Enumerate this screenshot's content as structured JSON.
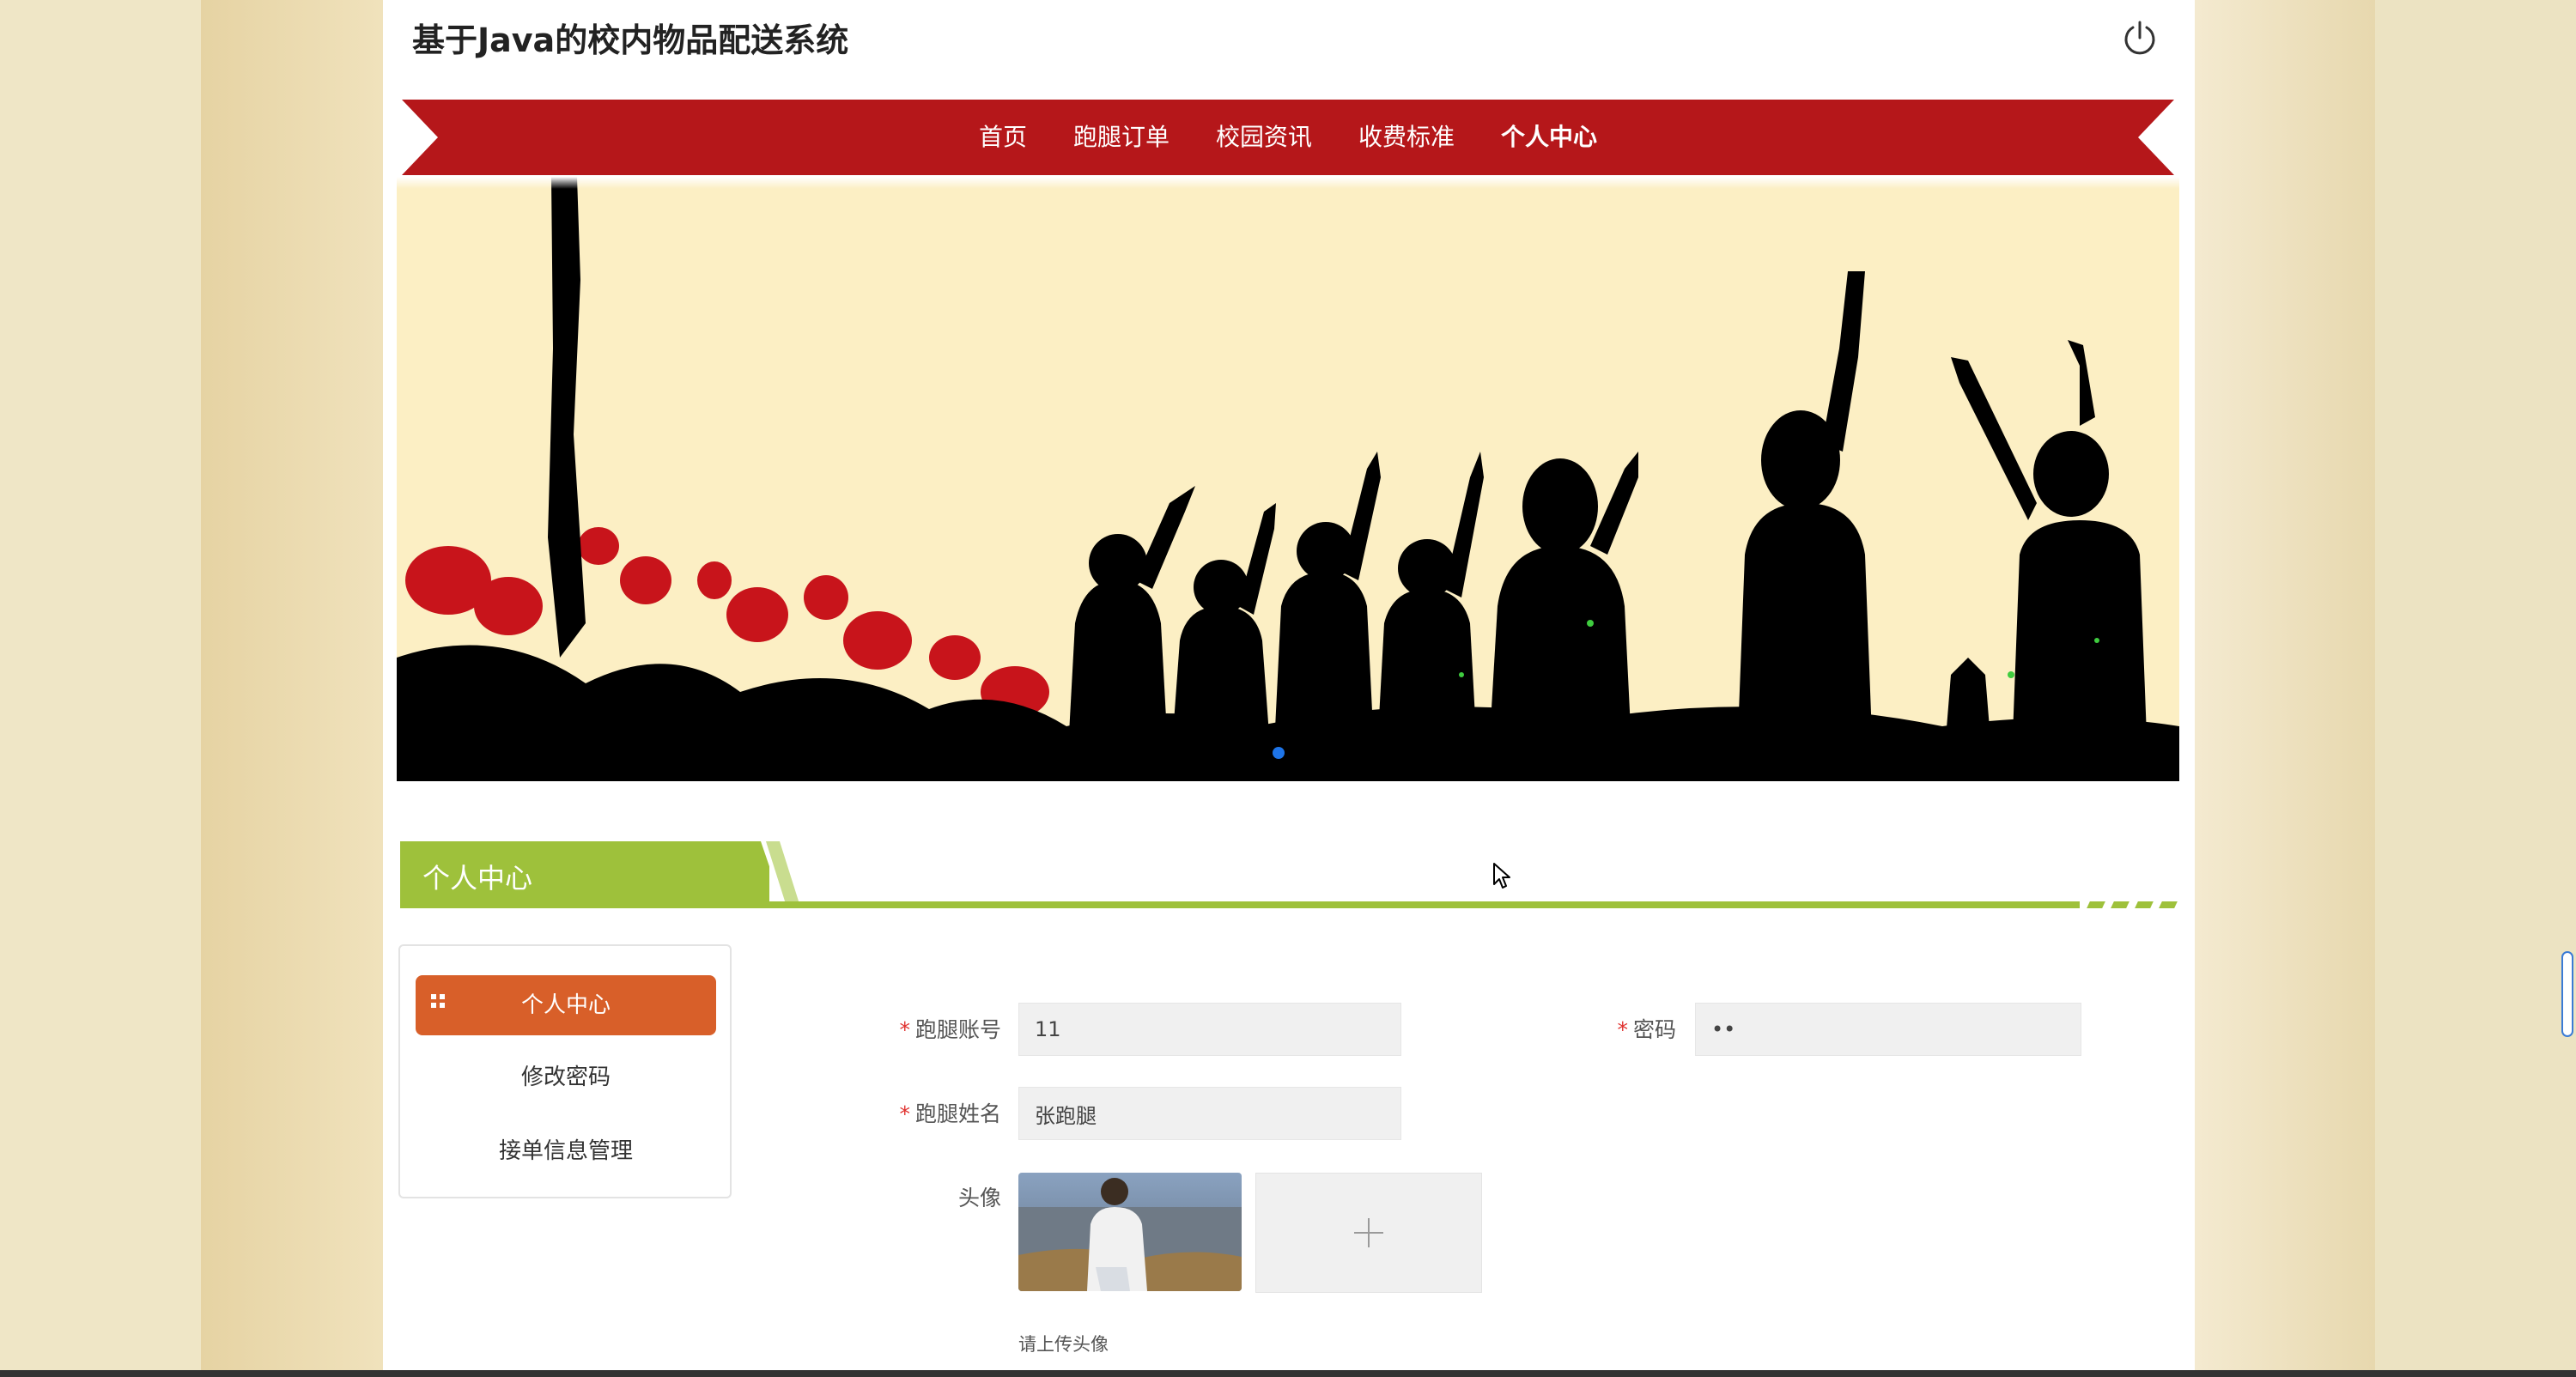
{
  "header": {
    "site_title": "基于Java的校内物品配送系统",
    "logout_icon": "power-icon"
  },
  "nav": {
    "items": [
      {
        "label": "首页"
      },
      {
        "label": "跑腿订单"
      },
      {
        "label": "校园资讯"
      },
      {
        "label": "收费标准"
      },
      {
        "label": "个人中心"
      }
    ],
    "active_index": 4,
    "bar_color": "#b5171a"
  },
  "banner": {
    "carousel_active_dot": 1
  },
  "section": {
    "title": "个人中心",
    "accent_color": "#9ec13b"
  },
  "side_menu": {
    "items": [
      {
        "label": "个人中心"
      },
      {
        "label": "修改密码"
      },
      {
        "label": "接单信息管理"
      }
    ],
    "active_index": 0,
    "active_color": "#d85f29"
  },
  "form": {
    "account": {
      "label": "跑腿账号",
      "required": "*",
      "value": "11"
    },
    "password": {
      "label": "密码",
      "required": "*",
      "value": "••"
    },
    "name": {
      "label": "跑腿姓名",
      "required": "*",
      "value": "张跑腿"
    },
    "avatar": {
      "label": "头像",
      "hint": "请上传头像"
    }
  }
}
